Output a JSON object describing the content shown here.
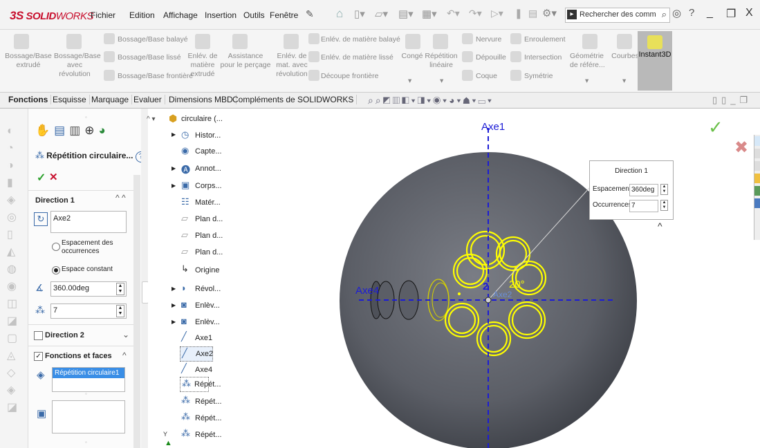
{
  "app": {
    "logo_ds": "3S",
    "logo_solid": "SOLID",
    "logo_works": "WORKS"
  },
  "menu": [
    "Fichier",
    "Edition",
    "Affichage",
    "Insertion",
    "Outils",
    "Fenêtre"
  ],
  "search": {
    "placeholder": "Rechercher des comm"
  },
  "ribbon": {
    "bossage_extrude": "Bossage/Base extrudé",
    "bossage_revol": "Bossage/Base avec révolution",
    "bossage_balaye": "Bossage/Base balayé",
    "bossage_lisse": "Bossage/Base lissé",
    "bossage_frontiere": "Bossage/Base frontière",
    "enlev_extrude": "Enlév. de matière extrudé",
    "assistance": "Assistance pour le perçage",
    "enlev_revol": "Enlév. de mat. avec révolution",
    "enlev_balaye": "Enlév. de matière balayé",
    "enlev_lisse": "Enlév. de matière lissé",
    "decoupe_frontiere": "Découpe frontière",
    "conge": "Congé",
    "repetition": "Répétition linéaire",
    "nervure": "Nervure",
    "depouille": "Dépouille",
    "coque": "Coque",
    "enroulement": "Enroulement",
    "intersection": "Intersection",
    "symetrie": "Symétrie",
    "geometrie": "Géométrie de référe...",
    "courbes": "Courbes",
    "instant3d": "Instant3D"
  },
  "tabs": [
    "Fonctions",
    "Esquisse",
    "Marquage",
    "Evaluer",
    "Dimensions MBD",
    "Compléments de SOLIDWORKS"
  ],
  "property_manager": {
    "title": "Répétition circulaire...",
    "direction1": "Direction 1",
    "axis_value": "Axe2",
    "option_espacement": "Espacement des occurrences",
    "option_constant": "Espace constant",
    "angle_value": "360.00deg",
    "count_value": "7",
    "direction2": "Direction 2",
    "fonctions_faces": "Fonctions et faces",
    "selected_feature": "Répétition circulaire1"
  },
  "tree": {
    "root": "circulaire (...",
    "items": [
      "Histor...",
      "Capte...",
      "Annot...",
      "Corps...",
      "Matér...",
      "Plan d...",
      "Plan d...",
      "Plan d...",
      "Origine",
      "Révol...",
      "Enlèv...",
      "Enlèv...",
      "Axe1",
      "Axe2",
      "Axe4",
      "Répét...",
      "Répét...",
      "Répét...",
      "Répét..."
    ]
  },
  "viewport": {
    "axe1": "Axe1",
    "axe4": "Axe4",
    "axe2": "Axe2",
    "dim_count": "2",
    "dim_angle": "20°",
    "callout_title": "Direction 1",
    "callout_espacement_label": "Espacement:",
    "callout_espacement_value": "360deg",
    "callout_occurrences_label": "Occurrences:",
    "callout_occurrences_value": "7"
  },
  "colors": {
    "accent_red": "#c8102e",
    "sketch_yellow": "#ffff00",
    "axis_blue": "#1c1cd6",
    "body_gray": "#5e6068"
  }
}
